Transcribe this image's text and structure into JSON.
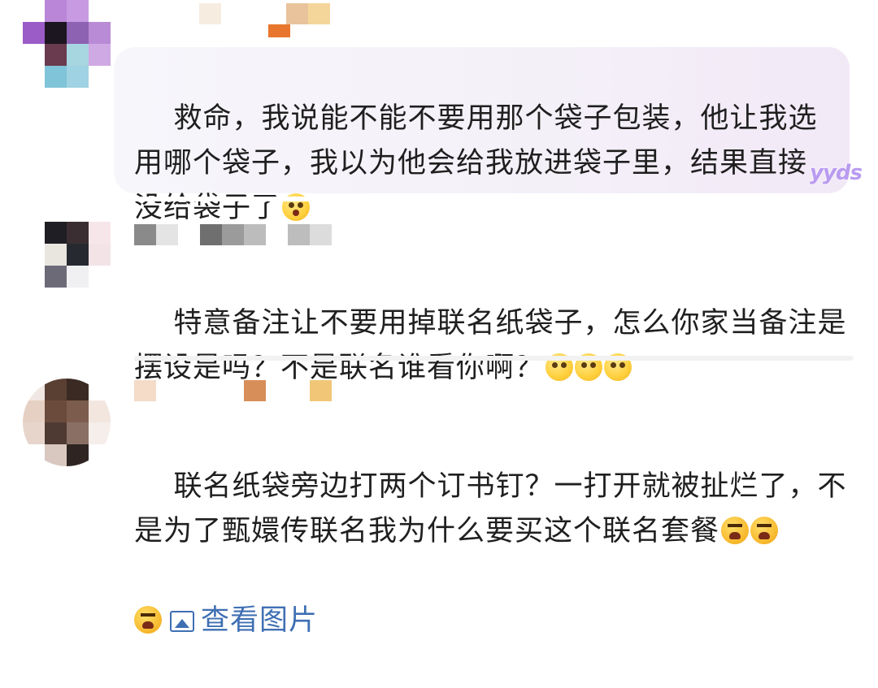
{
  "comments": [
    {
      "text": "救命，我说能不能不要用那个袋子包装，他让我选用哪个袋子，我以为他会给我放进袋子里，结果直接没给袋子了",
      "emojis": [
        "surprised-emoji"
      ],
      "badge": "yyds"
    },
    {
      "text": "特意备注让不要用掉联名纸袋子，怎么你家当备注是摆设是吗？不是联名谁看你啊？",
      "emojis": [
        "eye-roll-emoji",
        "eye-roll-emoji",
        "eye-roll-emoji"
      ]
    },
    {
      "text": "联名纸袋旁边打两个订书钉？一打开就被扯烂了，不是为了甄嬛传联名我为什么要买这个联名套餐",
      "emojis": [
        "angry-emoji",
        "angry-emoji",
        "angry-emoji"
      ],
      "view_images": "查看图片"
    }
  ]
}
